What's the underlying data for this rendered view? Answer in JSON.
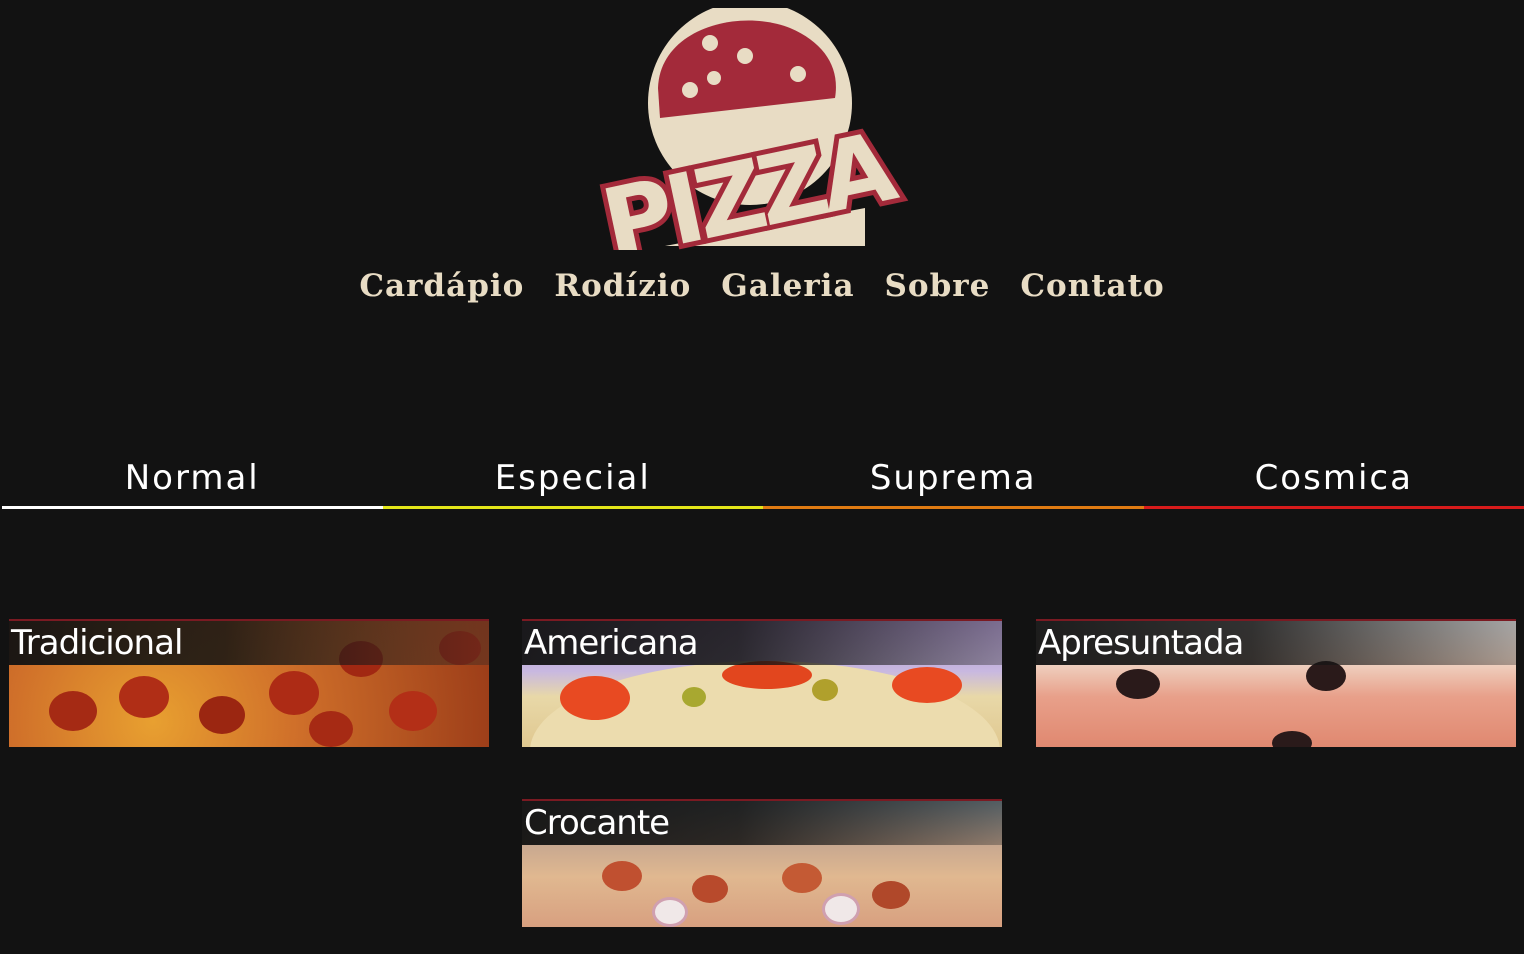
{
  "brand": {
    "logo_text": "PIZZA"
  },
  "nav": [
    {
      "label": "Cardápio"
    },
    {
      "label": "Rodízio"
    },
    {
      "label": "Galeria"
    },
    {
      "label": "Sobre"
    },
    {
      "label": "Contato"
    }
  ],
  "tabs": [
    {
      "label": "Normal",
      "color": "#ffffff"
    },
    {
      "label": "Especial",
      "color": "#e3e619"
    },
    {
      "label": "Suprema",
      "color": "#e07b12"
    },
    {
      "label": "Cosmica",
      "color": "#d81b1b"
    }
  ],
  "cards": [
    {
      "title": "Tradicional"
    },
    {
      "title": "Americana"
    },
    {
      "title": "Apresuntada"
    },
    {
      "title": "Crocante"
    }
  ],
  "colors": {
    "background": "#121212",
    "cream": "#e8dcc4",
    "brand_red": "#a32a3a"
  }
}
